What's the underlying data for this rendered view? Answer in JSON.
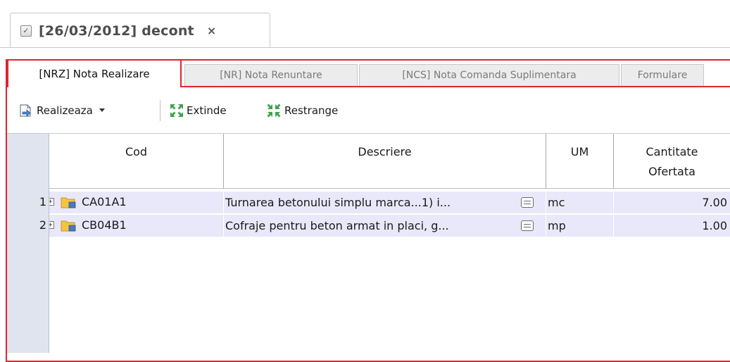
{
  "document_tab": {
    "title": "[26/03/2012] decont",
    "close": "×"
  },
  "sub_tabs": [
    {
      "label": "[NRZ] Nota Realizare",
      "active": true
    },
    {
      "label": "[NR] Nota Renuntare",
      "active": false
    },
    {
      "label": "[NCS] Nota Comanda Suplimentara",
      "active": false
    },
    {
      "label": "Formulare",
      "active": false
    }
  ],
  "toolbar": {
    "realizeaza_label": "Realizeaza",
    "extinde_label": "Extinde",
    "restrange_label": "Restrange"
  },
  "grid": {
    "columns": {
      "cod": "Cod",
      "descriere": "Descriere",
      "um": "UM",
      "cantitate_line1": "Cantitate",
      "cantitate_line2": "Ofertata"
    },
    "rows": [
      {
        "num": "1",
        "cod": "CA01A1",
        "descriere": "Turnarea betonului simplu marca...1) i...",
        "um": "mc",
        "cantitate": "7.00"
      },
      {
        "num": "2",
        "cod": "CB04B1",
        "descriere": "Cofraje pentru beton armat in placi, g...",
        "um": "mp",
        "cantitate": "1.00"
      }
    ]
  },
  "colors": {
    "accent_red": "#e0242f",
    "row_bg": "#e8e8fa",
    "indicator_bg": "#dfe4ee"
  },
  "icons": [
    "checkbox-icon",
    "close-icon",
    "realizeaza-icon",
    "dropdown-arrow-icon",
    "extinde-icon",
    "restrange-icon",
    "expand-plus-icon",
    "folder-icon",
    "note-icon"
  ]
}
